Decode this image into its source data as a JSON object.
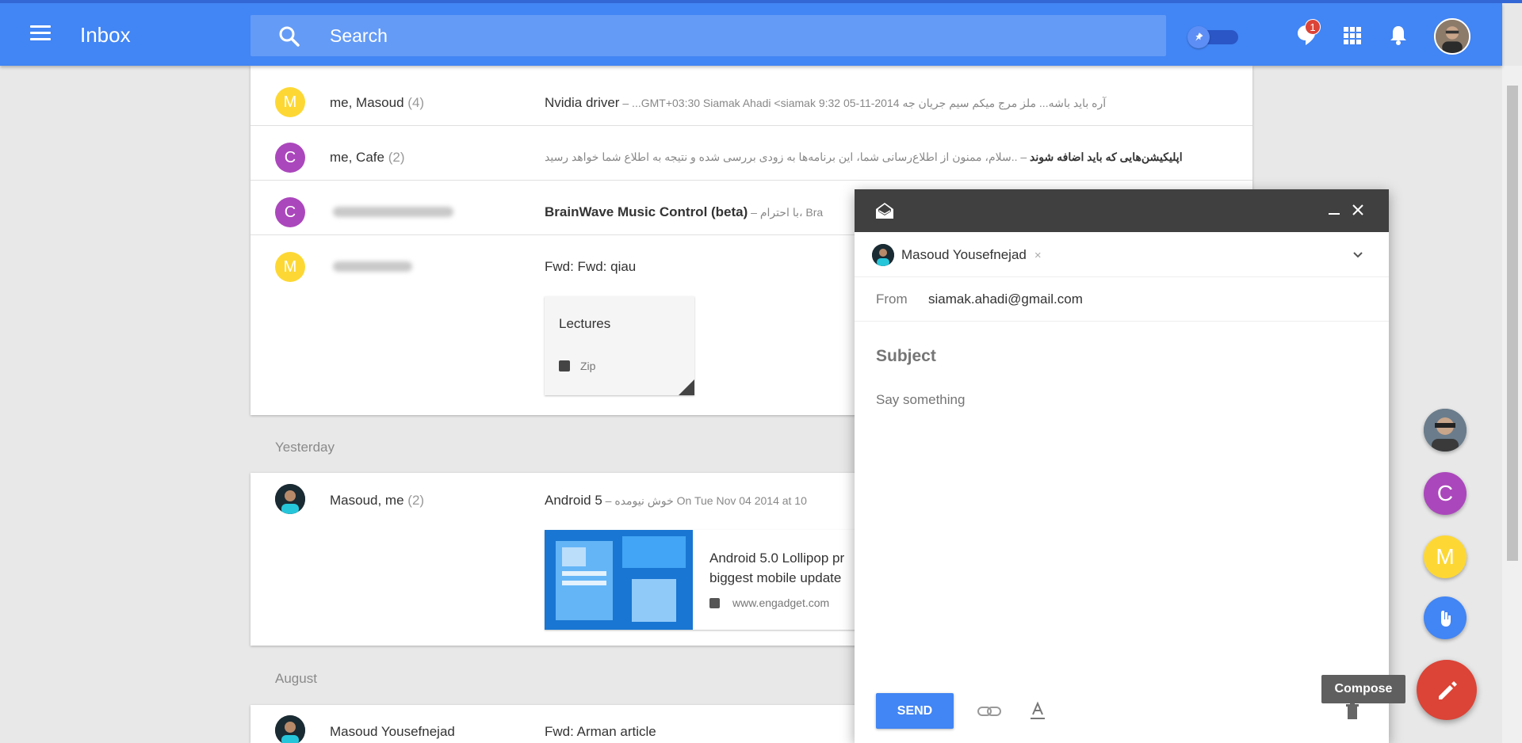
{
  "header": {
    "app_title": "Inbox",
    "search_placeholder": "Search",
    "notification_count": "1"
  },
  "threads": [
    {
      "avatar_letter": "M",
      "avatar_color": "#fdd835",
      "sender": "me, Masoud",
      "count": "(4)",
      "subject": "Nvidia driver",
      "snippet": " – ...GMT+03:30 Siamak Ahadi <siamak 9:32 05-11-2014 آره باید باشه... ملز مرج میکم سیم جریان جه"
    },
    {
      "avatar_letter": "C",
      "avatar_color": "#ab47bc",
      "sender": "me, Cafe",
      "count": "(2)",
      "subject": "اپلیکیشن‌هایی که باید اضافه شوند",
      "snippet": " – ..سلام، ممنون از اطلاع‌رسانی شما، این برنامه‌ها به زودی بررسی شده و نتیجه به اطلاع شما خواهد رسید"
    },
    {
      "avatar_letter": "C",
      "avatar_color": "#ab47bc",
      "sender": "",
      "count": "",
      "subject": "BrainWave Music Control (beta)",
      "snippet": " – با احترام، Bra"
    },
    {
      "avatar_letter": "M",
      "avatar_color": "#fdd835",
      "sender": "",
      "count": "",
      "subject": "Fwd: Fwd: qiau",
      "snippet": ""
    }
  ],
  "attachment": {
    "title": "Lectures",
    "type": "Zip"
  },
  "groups": {
    "yesterday": "Yesterday",
    "august": "August"
  },
  "yesterday_thread": {
    "sender": "Masoud, me",
    "count": "(2)",
    "subject": "Android 5",
    "snippet": " – خوش نیومده On Tue Nov 04 2014 at 10",
    "link_title_1": "Android 5.0 Lollipop pr",
    "link_title_2": "biggest mobile update",
    "link_domain": "www.engadget.com"
  },
  "august_thread": {
    "sender": "Masoud Yousefnejad",
    "subject": "Fwd: Arman article"
  },
  "compose": {
    "recipient": "Masoud Yousefnejad",
    "from_label": "From",
    "from_value": "siamak.ahadi@gmail.com",
    "subject_placeholder": "Subject",
    "body_placeholder": "Say something",
    "send_label": "SEND"
  },
  "fab": {
    "speed_dial": [
      {
        "type": "photo",
        "letter": ""
      },
      {
        "type": "letter",
        "letter": "C",
        "color": "#ab47bc"
      },
      {
        "type": "letter",
        "letter": "M",
        "color": "#fdd835"
      },
      {
        "type": "reminder",
        "letter": "",
        "color": "#4285f4"
      }
    ],
    "tooltip": "Compose",
    "accent": "#db4437"
  }
}
